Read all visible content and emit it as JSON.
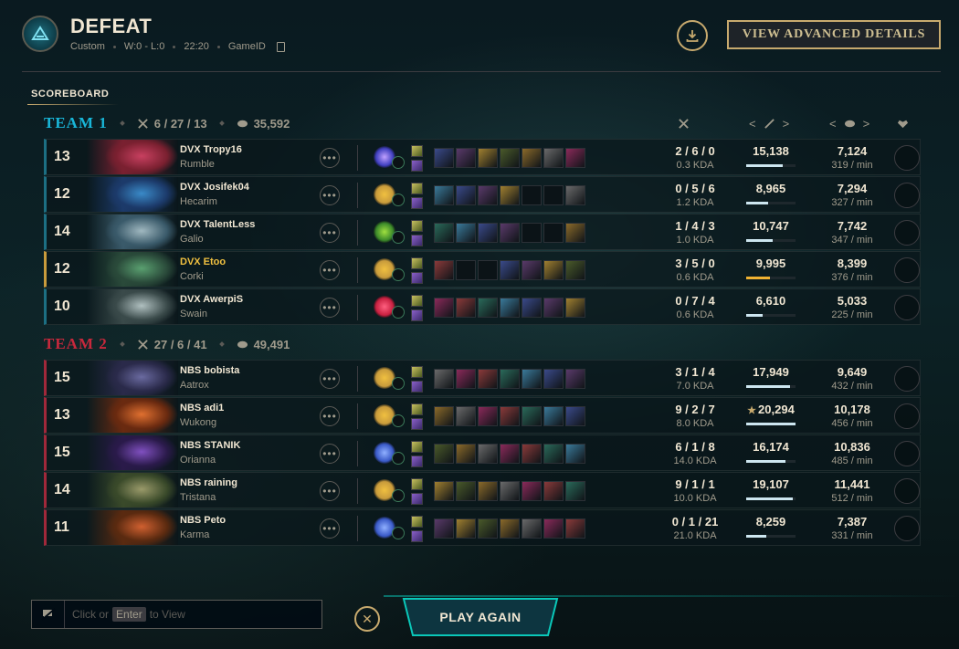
{
  "header": {
    "result": "DEFEAT",
    "mode": "Custom",
    "record": "W:0 - L:0",
    "duration": "22:20",
    "game_id_label": "GameID",
    "advanced_button": "VIEW ADVANCED DETAILS"
  },
  "scoreboard_label": "SCOREBOARD",
  "teams": [
    {
      "name": "TEAM 1",
      "kda": "6 / 27 / 13",
      "gold": "35,592",
      "players": [
        {
          "level": "13",
          "name": "DVX Tropy16",
          "champion": "Rumble",
          "kda": "2 / 6 / 0",
          "kda_ratio": "0.3 KDA",
          "damage": "15,138",
          "damage_fraction": 0.74,
          "gold": "7,124",
          "gold_per_min": "319 / min",
          "is_self": false
        },
        {
          "level": "12",
          "name": "DVX Josifek04",
          "champion": "Hecarim",
          "kda": "0 / 5 / 6",
          "kda_ratio": "1.2 KDA",
          "damage": "8,965",
          "damage_fraction": 0.44,
          "gold": "7,294",
          "gold_per_min": "327 / min",
          "is_self": false
        },
        {
          "level": "14",
          "name": "DVX TalentLess",
          "champion": "Galio",
          "kda": "1 / 4 / 3",
          "kda_ratio": "1.0 KDA",
          "damage": "10,747",
          "damage_fraction": 0.53,
          "gold": "7,742",
          "gold_per_min": "347 / min",
          "is_self": false
        },
        {
          "level": "12",
          "name": "DVX Etoo",
          "champion": "Corki",
          "kda": "3 / 5 / 0",
          "kda_ratio": "0.6 KDA",
          "damage": "9,995",
          "damage_fraction": 0.49,
          "gold": "8,399",
          "gold_per_min": "376 / min",
          "is_self": true
        },
        {
          "level": "10",
          "name": "DVX AwerpiS",
          "champion": "Swain",
          "kda": "0 / 7 / 4",
          "kda_ratio": "0.6 KDA",
          "damage": "6,610",
          "damage_fraction": 0.33,
          "gold": "5,033",
          "gold_per_min": "225 / min",
          "is_self": false
        }
      ]
    },
    {
      "name": "TEAM 2",
      "kda": "27 / 6 / 41",
      "gold": "49,491",
      "players": [
        {
          "level": "15",
          "name": "NBS bobista",
          "champion": "Aatrox",
          "kda": "3 / 1 / 4",
          "kda_ratio": "7.0 KDA",
          "damage": "17,949",
          "damage_fraction": 0.88,
          "gold": "9,649",
          "gold_per_min": "432 / min",
          "is_self": false
        },
        {
          "level": "13",
          "name": "NBS adi1",
          "champion": "Wukong",
          "kda": "9 / 2 / 7",
          "kda_ratio": "8.0 KDA",
          "damage": "20,294",
          "damage_fraction": 1.0,
          "gold": "10,178",
          "gold_per_min": "456 / min",
          "is_self": false,
          "top_damage": true
        },
        {
          "level": "15",
          "name": "NBS STANIK",
          "champion": "Orianna",
          "kda": "6 / 1 / 8",
          "kda_ratio": "14.0 KDA",
          "damage": "16,174",
          "damage_fraction": 0.8,
          "gold": "10,836",
          "gold_per_min": "485 / min",
          "is_self": false
        },
        {
          "level": "14",
          "name": "NBS raining",
          "champion": "Tristana",
          "kda": "9 / 1 / 1",
          "kda_ratio": "10.0 KDA",
          "damage": "19,107",
          "damage_fraction": 0.94,
          "gold": "11,441",
          "gold_per_min": "512 / min",
          "is_self": false
        },
        {
          "level": "11",
          "name": "NBS Peto",
          "champion": "Karma",
          "kda": "0 / 1 / 21",
          "kda_ratio": "21.0 KDA",
          "damage": "8,259",
          "damage_fraction": 0.41,
          "gold": "7,387",
          "gold_per_min": "331 / min",
          "is_self": false
        }
      ]
    }
  ],
  "chat": {
    "prefix": "Click or",
    "key": "Enter",
    "suffix": "to View"
  },
  "play_again": "PLAY AGAIN",
  "colors": {
    "gold": "#c8aa6e",
    "team1": "#19b6d8",
    "team2": "#c8283c",
    "self": "#f0c040"
  }
}
